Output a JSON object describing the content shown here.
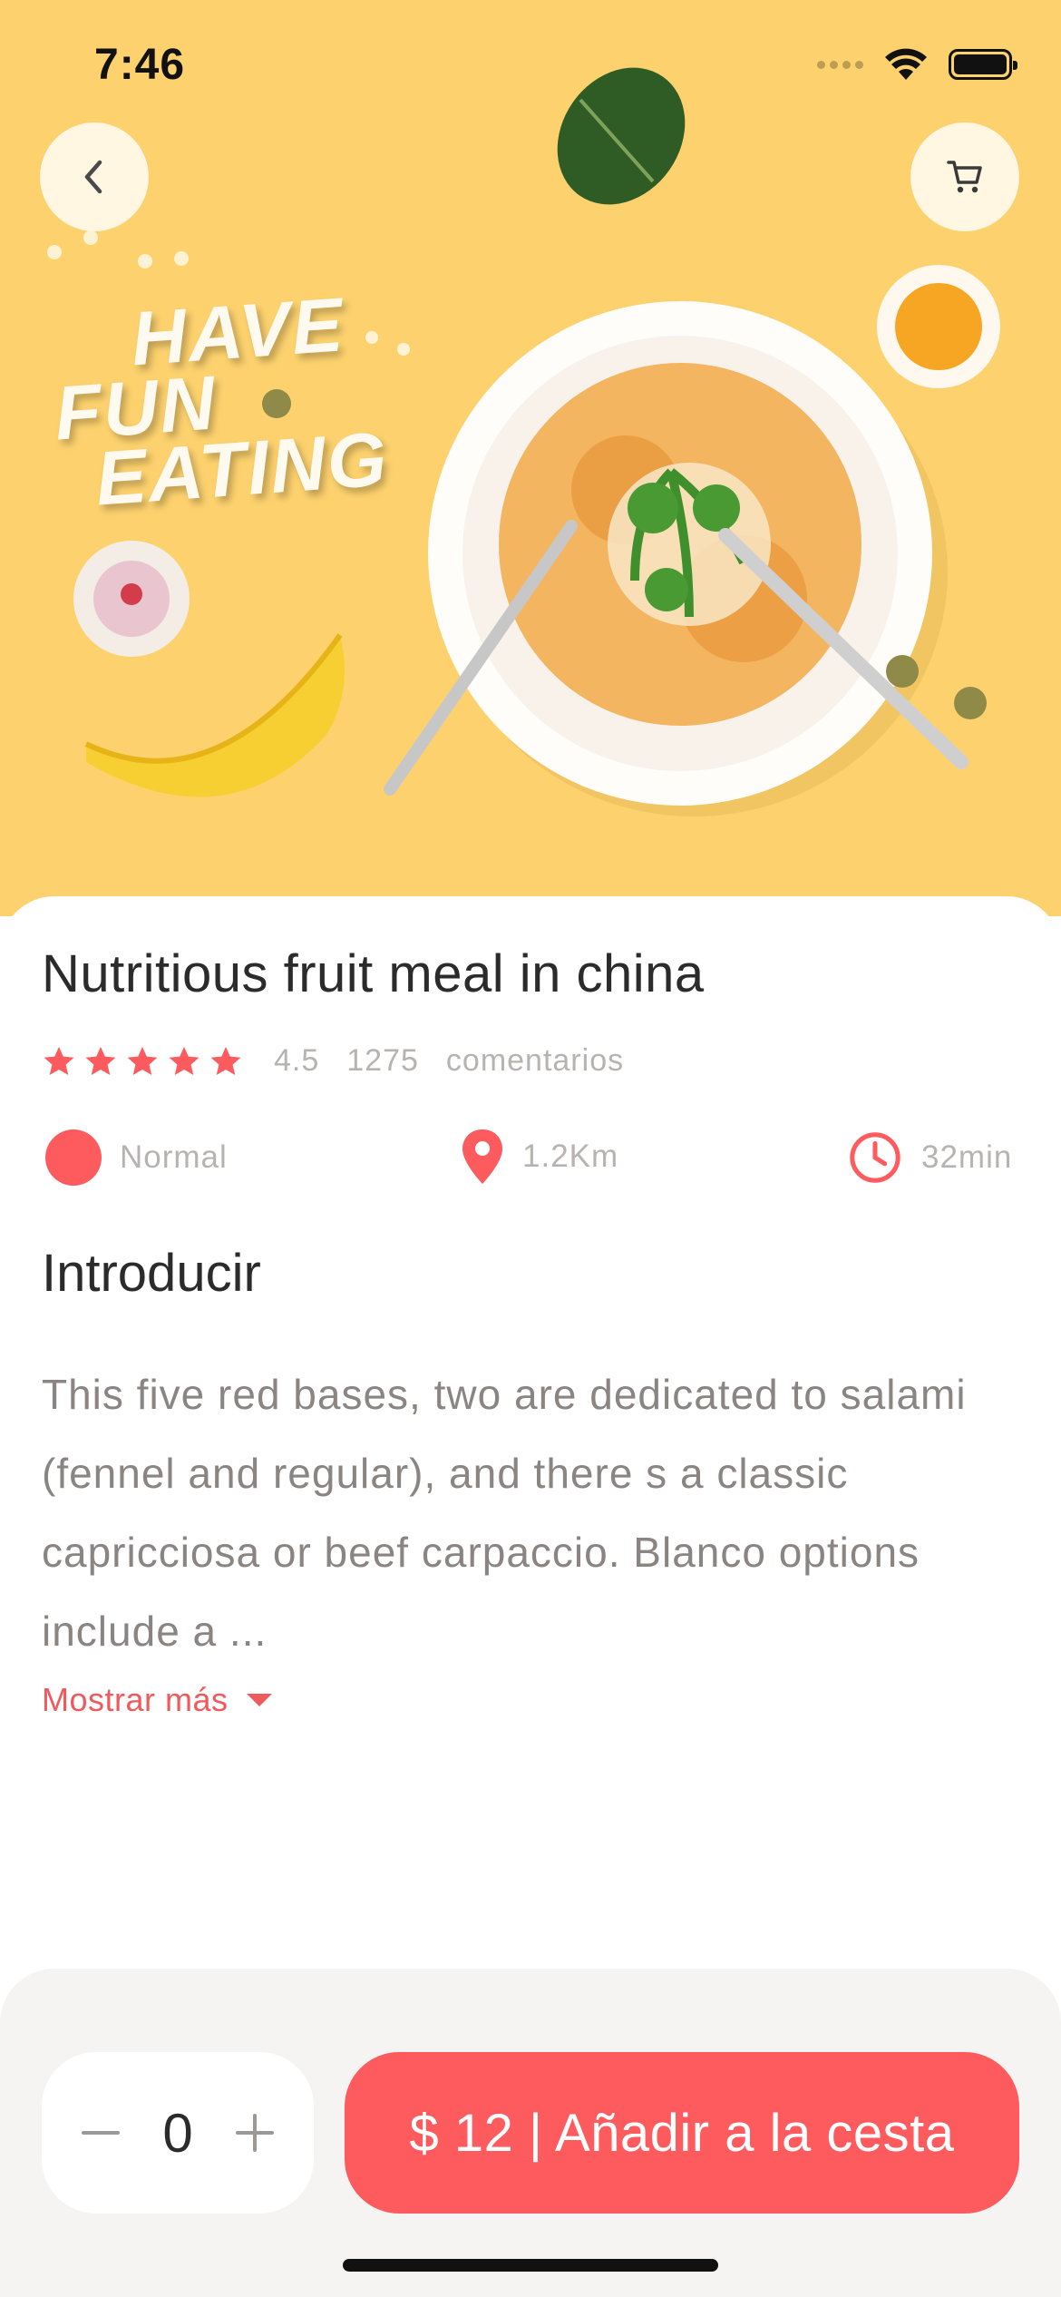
{
  "status_bar": {
    "time": "7:46"
  },
  "hero": {
    "banner_text": [
      "HAVE",
      "FUN",
      "EATING"
    ],
    "background": "#fdd26e"
  },
  "product": {
    "title": "Nutritious fruit meal in china",
    "rating": "4.5",
    "reviews_count": "1275",
    "reviews_label": "comentarios",
    "stars": 5,
    "level": "Normal",
    "distance": "1.2Km",
    "time": "32min",
    "section_title": "Introducir",
    "description": "This five red bases, two are dedicated to salami (fennel and regular), and there s a classic capricciosa or beef carpaccio. Blanco options include a ...",
    "show_more": "Mostrar más"
  },
  "cart": {
    "quantity": "0",
    "add_button_label": "$ 12 | Añadir a la cesta"
  },
  "colors": {
    "accent": "#fe5b5f",
    "muted_text": "#b7b3b0",
    "body_text": "#8a8582"
  },
  "icons": [
    "back-icon",
    "cart-icon",
    "star-icon",
    "location-pin-icon",
    "clock-icon",
    "caret-down-icon",
    "minus-icon",
    "plus-icon"
  ]
}
